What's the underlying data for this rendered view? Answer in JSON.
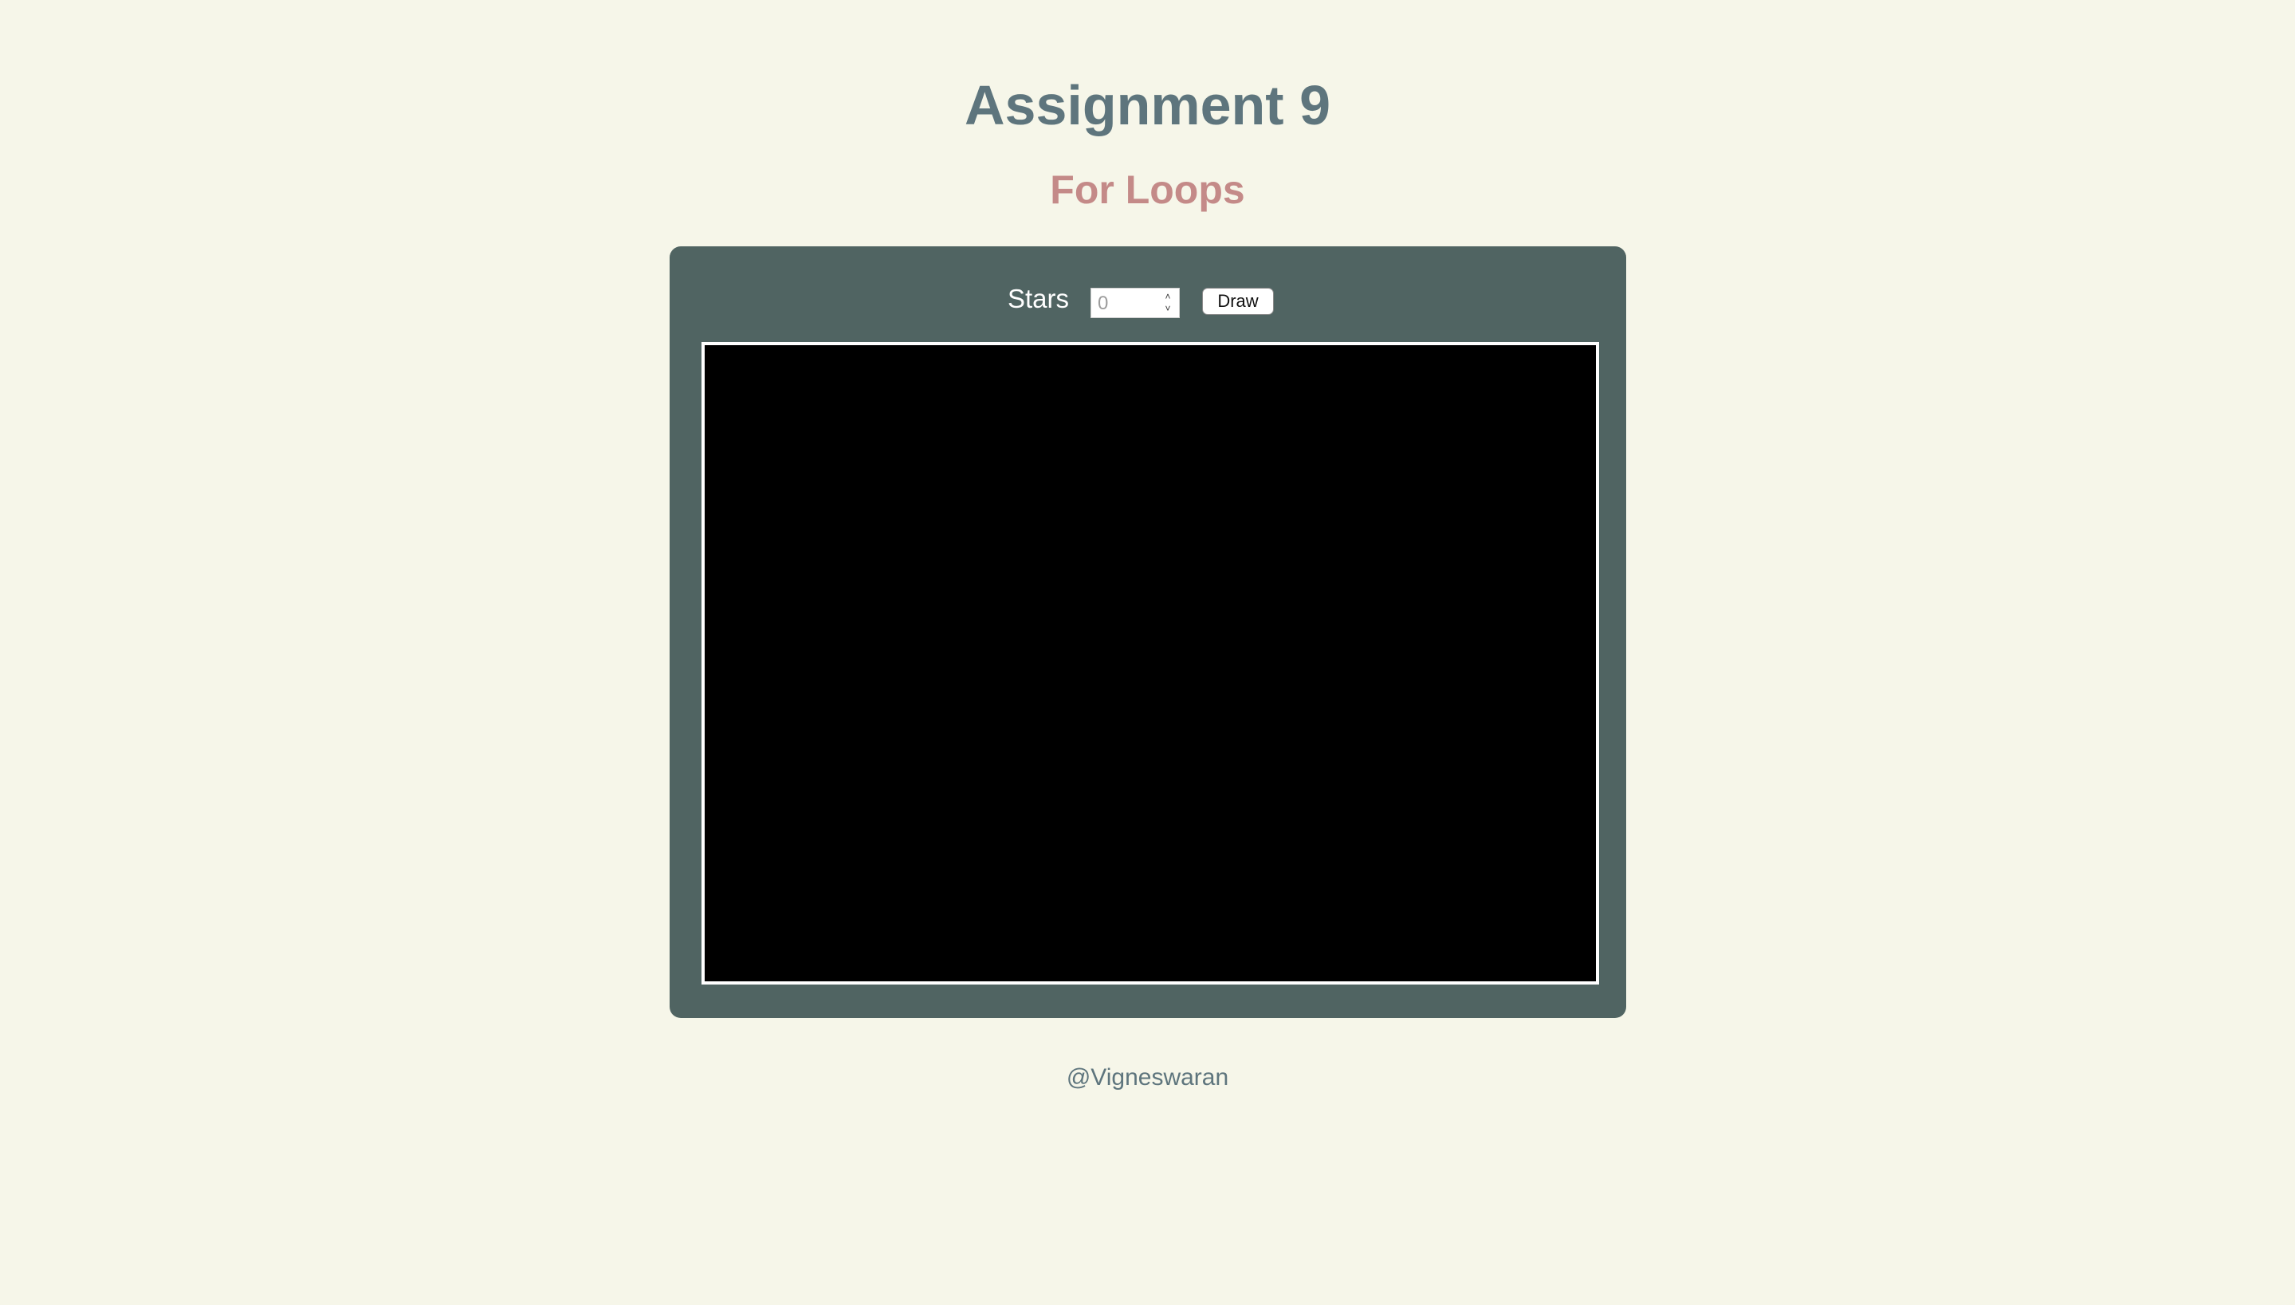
{
  "page": {
    "title": "Assignment 9",
    "subtitle": "For Loops",
    "credit": "@Vigneswaran"
  },
  "controls": {
    "stars_label": "Stars",
    "stars_input": {
      "value": "",
      "placeholder": "0"
    },
    "draw_label": "Draw"
  },
  "icons": {
    "spin_up": "chevron-up-icon",
    "spin_down": "chevron-down-icon"
  },
  "colors": {
    "background": "#f6f6e9",
    "title": "#5e757d",
    "subtitle": "#c48a88",
    "panel": "#506462",
    "canvas": "#000000",
    "canvas_border": "#ffffff"
  }
}
